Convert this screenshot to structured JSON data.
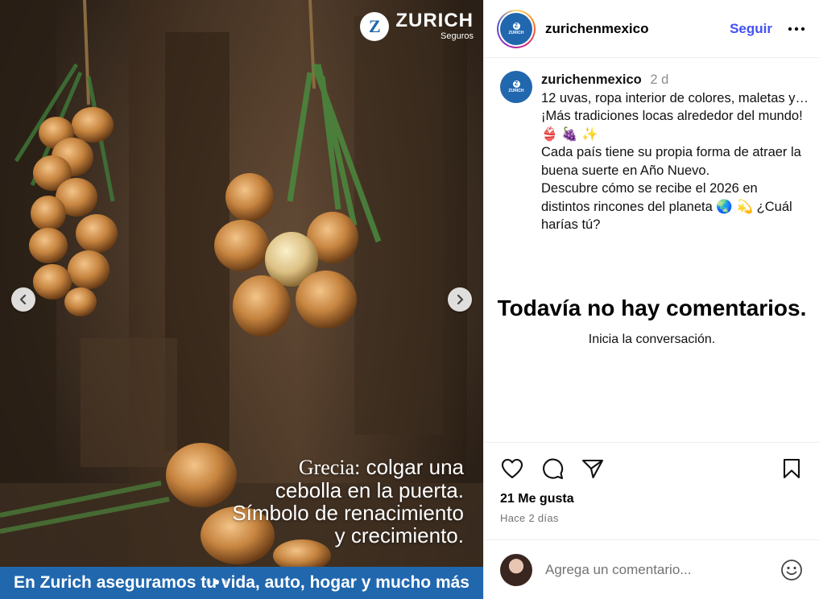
{
  "post": {
    "brand": {
      "name": "ZURICH",
      "sub": "Seguros",
      "mark": "Z"
    },
    "overlay": {
      "line1_serif": "Grecia:",
      "line1_rest": " colgar una",
      "line2": "cebolla en la puerta.",
      "line3": "Símbolo de renacimiento",
      "line4": "y crecimiento."
    },
    "banner": "En Zurich aseguramos tu vida, auto, hogar y mucho más",
    "carousel": {
      "dots": 3,
      "active_index": 1
    }
  },
  "header": {
    "username": "zurichenmexico",
    "follow_label": "Seguir",
    "more_icon": "more-horizontal-icon"
  },
  "caption": {
    "username": "zurichenmexico",
    "time": "2 d",
    "lines": [
      "12 uvas, ropa interior de colores, maletas y… ¡Más tradiciones locas alrededor del mundo! 👙 🍇 ✨",
      "Cada país tiene su propia forma de atraer la buena suerte en Año Nuevo.",
      "Descubre cómo se recibe el 2026 en distintos rincones del planeta 🌏 💫 ¿Cuál harías tú?"
    ]
  },
  "comments": {
    "empty_title": "Todavía no hay comentarios.",
    "empty_subtitle": "Inicia la conversación."
  },
  "actions": {
    "icons": [
      "heart-icon",
      "comment-icon",
      "share-icon",
      "bookmark-icon"
    ],
    "likes": "21 Me gusta",
    "date": "Hace 2 días"
  },
  "comment_box": {
    "placeholder": "Agrega un comentario...",
    "emoji_icon": "smiley-icon"
  },
  "colors": {
    "zurich_blue": "#2167ae",
    "follow_blue": "#4150f7",
    "muted": "#737373"
  }
}
